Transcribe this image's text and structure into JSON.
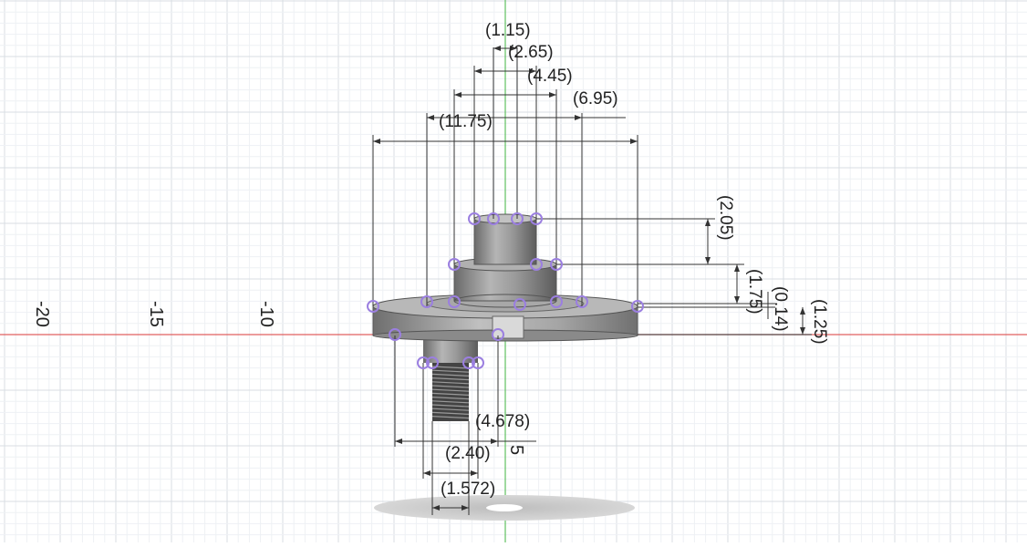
{
  "viewport": {
    "axis_labels": [
      "-20",
      "-15",
      "-10",
      "5"
    ],
    "dimensions": {
      "d_1_15": "(1.15)",
      "d_2_65": "(2.65)",
      "d_4_45": "(4.45)",
      "d_6_95": "(6.95)",
      "d_11_75": "(11.75)",
      "d_2_05": "(2.05)",
      "d_1_75": "(1.75)",
      "d_0_14": "(0.14)",
      "d_1_25": "(1.25)",
      "d_4_678": "(4.678)",
      "d_2_40": "(2.40)",
      "d_1_572": "(1.572)"
    },
    "colors": {
      "x_axis": "#e06060",
      "y_axis": "#60c060",
      "grid_major": "#d8dde3",
      "grid_minor": "#eef1f4",
      "body": "#7a7a7a",
      "sketch_point": "#9b7fe0"
    }
  }
}
